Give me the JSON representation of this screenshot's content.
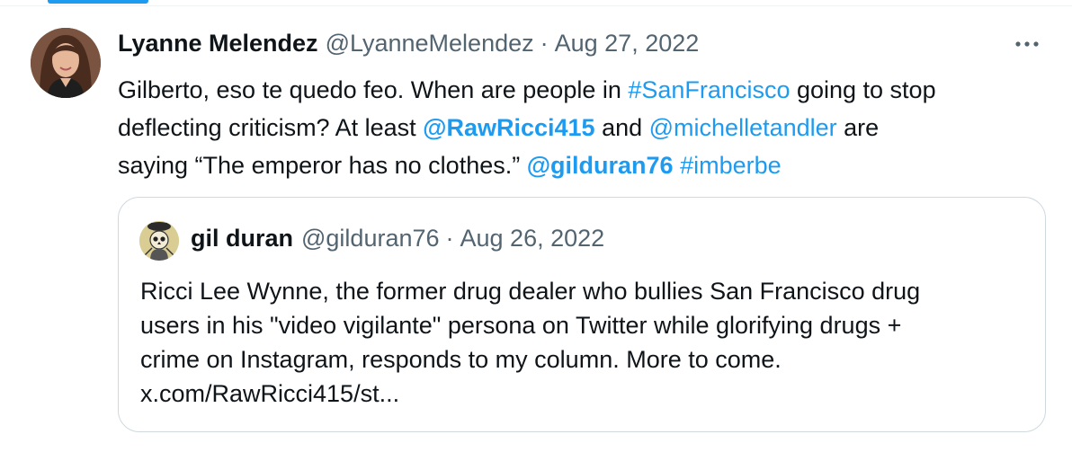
{
  "tweet": {
    "author": {
      "display_name": "Lyanne Melendez",
      "handle": "@LyanneMelendez",
      "avatar_icon": "profile-photo-avatar"
    },
    "separator": "·",
    "date": "Aug 27, 2022",
    "more_icon": "more-horizontal-icon",
    "text": {
      "line1_a": "Gilberto, eso te quedo feo. When are people in ",
      "hashtag_sf": "#SanFrancisco",
      "line1_b": " going to stop",
      "line2_a": "deflecting criticism? At least ",
      "mention_rawricci": "@RawRicci415",
      "line2_b": " and ",
      "mention_michelle": "@michelletandler",
      "line2_c": " are",
      "line3_a": "saying “The emperor has no clothes.” ",
      "mention_gilduran": "@gilduran76",
      "line3_b": " ",
      "hashtag_imberbe": "#imberbe"
    }
  },
  "quote": {
    "author": {
      "display_name": "gil duran",
      "handle": "@gilduran76",
      "avatar_icon": "skull-avatar"
    },
    "separator": "·",
    "date": "Aug 26, 2022",
    "text": {
      "line1": "Ricci Lee Wynne, the former drug dealer who bullies San Francisco drug",
      "line2": "users in his \"video vigilante\" persona on Twitter while glorifying drugs +",
      "line3": "crime on Instagram, responds to my column. More to come.",
      "line4": "x.com/RawRicci415/st..."
    }
  },
  "colors": {
    "link": "#1d9bf0",
    "secondary_text": "#536471",
    "primary_text": "#0f1419",
    "border": "#cfd9de"
  }
}
